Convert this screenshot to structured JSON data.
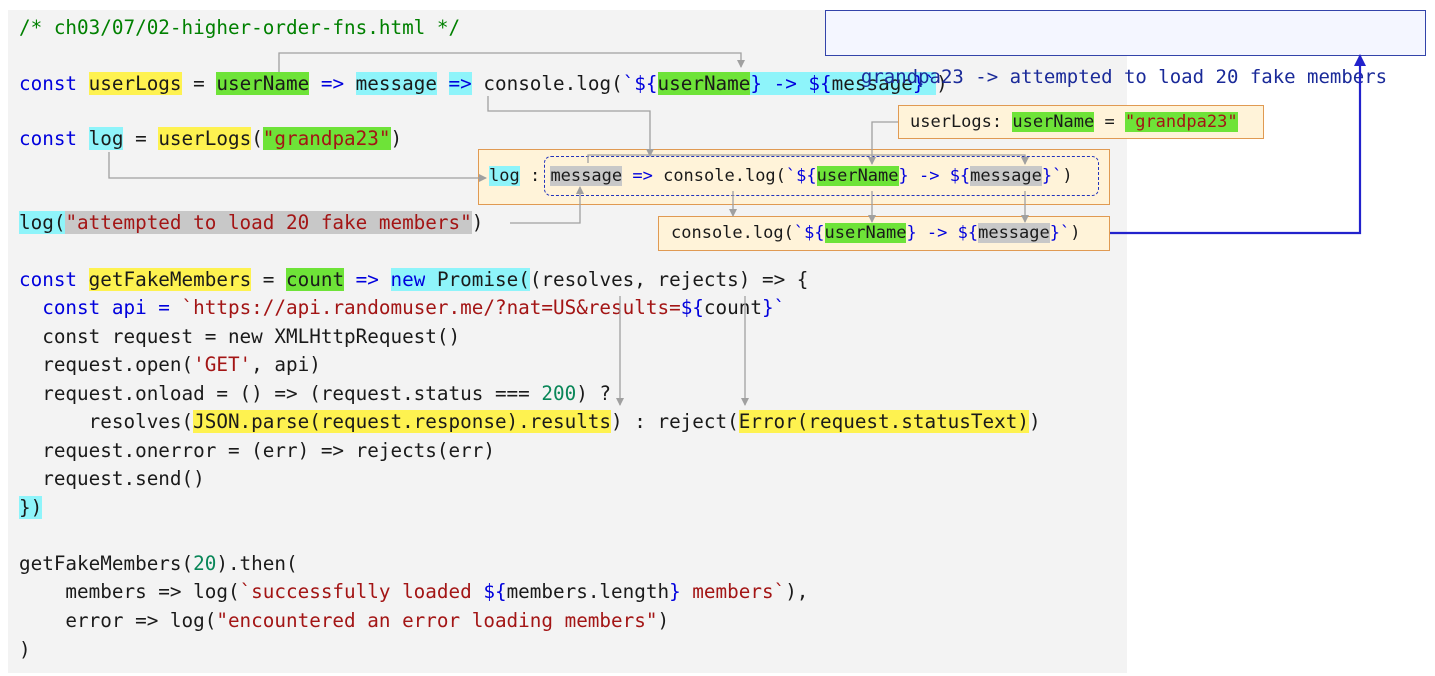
{
  "code": {
    "comment": "/* ch03/07/02-higher-order-fns.html */",
    "kw_const": "const",
    "kw_new": "new",
    "arrow": "=>",
    "eq": " = ",
    "ident": {
      "userLogs": "userLogs",
      "userName": "userName",
      "message": "message",
      "log": "log",
      "getFakeMembers": "getFakeMembers",
      "count": "count"
    },
    "str_grandpa": "\"grandpa23\"",
    "str_attempted": "\"attempted to load 20 fake members\"",
    "tpl_open": "`${",
    "tpl_mid": "} -> ${",
    "tpl_close": "}`",
    "console_log": "console.log(",
    "line2_tail": ")",
    "line3_open": "(",
    "line3_close": ")",
    "line4_call": "log(",
    "line4_close": ")",
    "promise_head": "Promise(",
    "promise_tail": "(resolves, rejects) => {",
    "api_name": "  const api = ",
    "api_url": "`https://api.randomuser.me/?nat=US&results=",
    "api_dollar": "${",
    "api_count": "count",
    "api_close": "}`",
    "request_new": "  const request = new XMLHttpRequest()",
    "open_call": "  request.open(",
    "open_get": "'GET'",
    "open_rest": ", api)",
    "onload_pre": "  request.onload = () => (request.status === ",
    "onload_num": "200",
    "onload_post": ") ?",
    "resolves_pre": "      resolves(",
    "resolves_hl": "JSON.parse(request.response).results",
    "resolves_mid": ") : reject(",
    "reject_hl": "Error(request.statusText)",
    "reject_close": ")",
    "onerror": "  request.onerror = (err) => rejects(err)",
    "send": "  request.send()",
    "close_block": "})",
    "then_pre": "getFakeMembers(",
    "then_num": "20",
    "then_post": ").then(",
    "members_pre": "    members => log(",
    "members_str_a": "`successfully loaded ",
    "members_dollar": "${",
    "members_len": "members.length",
    "members_close": "}",
    "members_str_b": " members`",
    "members_end": "),",
    "error_pre": "    error => log(",
    "error_str": "\"encountered an error loading members\"",
    "error_end": ")",
    "final_close": ")"
  },
  "annotations": {
    "output": "grandpa23 -> attempted to load 20 fake members",
    "binding_label": "userLogs: ",
    "binding_eq": " = ",
    "log_label": "log",
    "colon": " : ",
    "console_call_end": ")"
  },
  "colors": {
    "yellow_highlight": "#fef250",
    "green_highlight": "#6ee338",
    "cyan_highlight": "#8ef4fa",
    "gray_highlight": "#c8c8c8",
    "keyword": "#0000dd",
    "string": "#a31515",
    "number": "#098658",
    "comment": "#008000",
    "output_border": "#3344aa",
    "output_arrow": "#2222cc",
    "annotation_border": "#e09a52",
    "annotation_fill": "#fff3d9"
  }
}
